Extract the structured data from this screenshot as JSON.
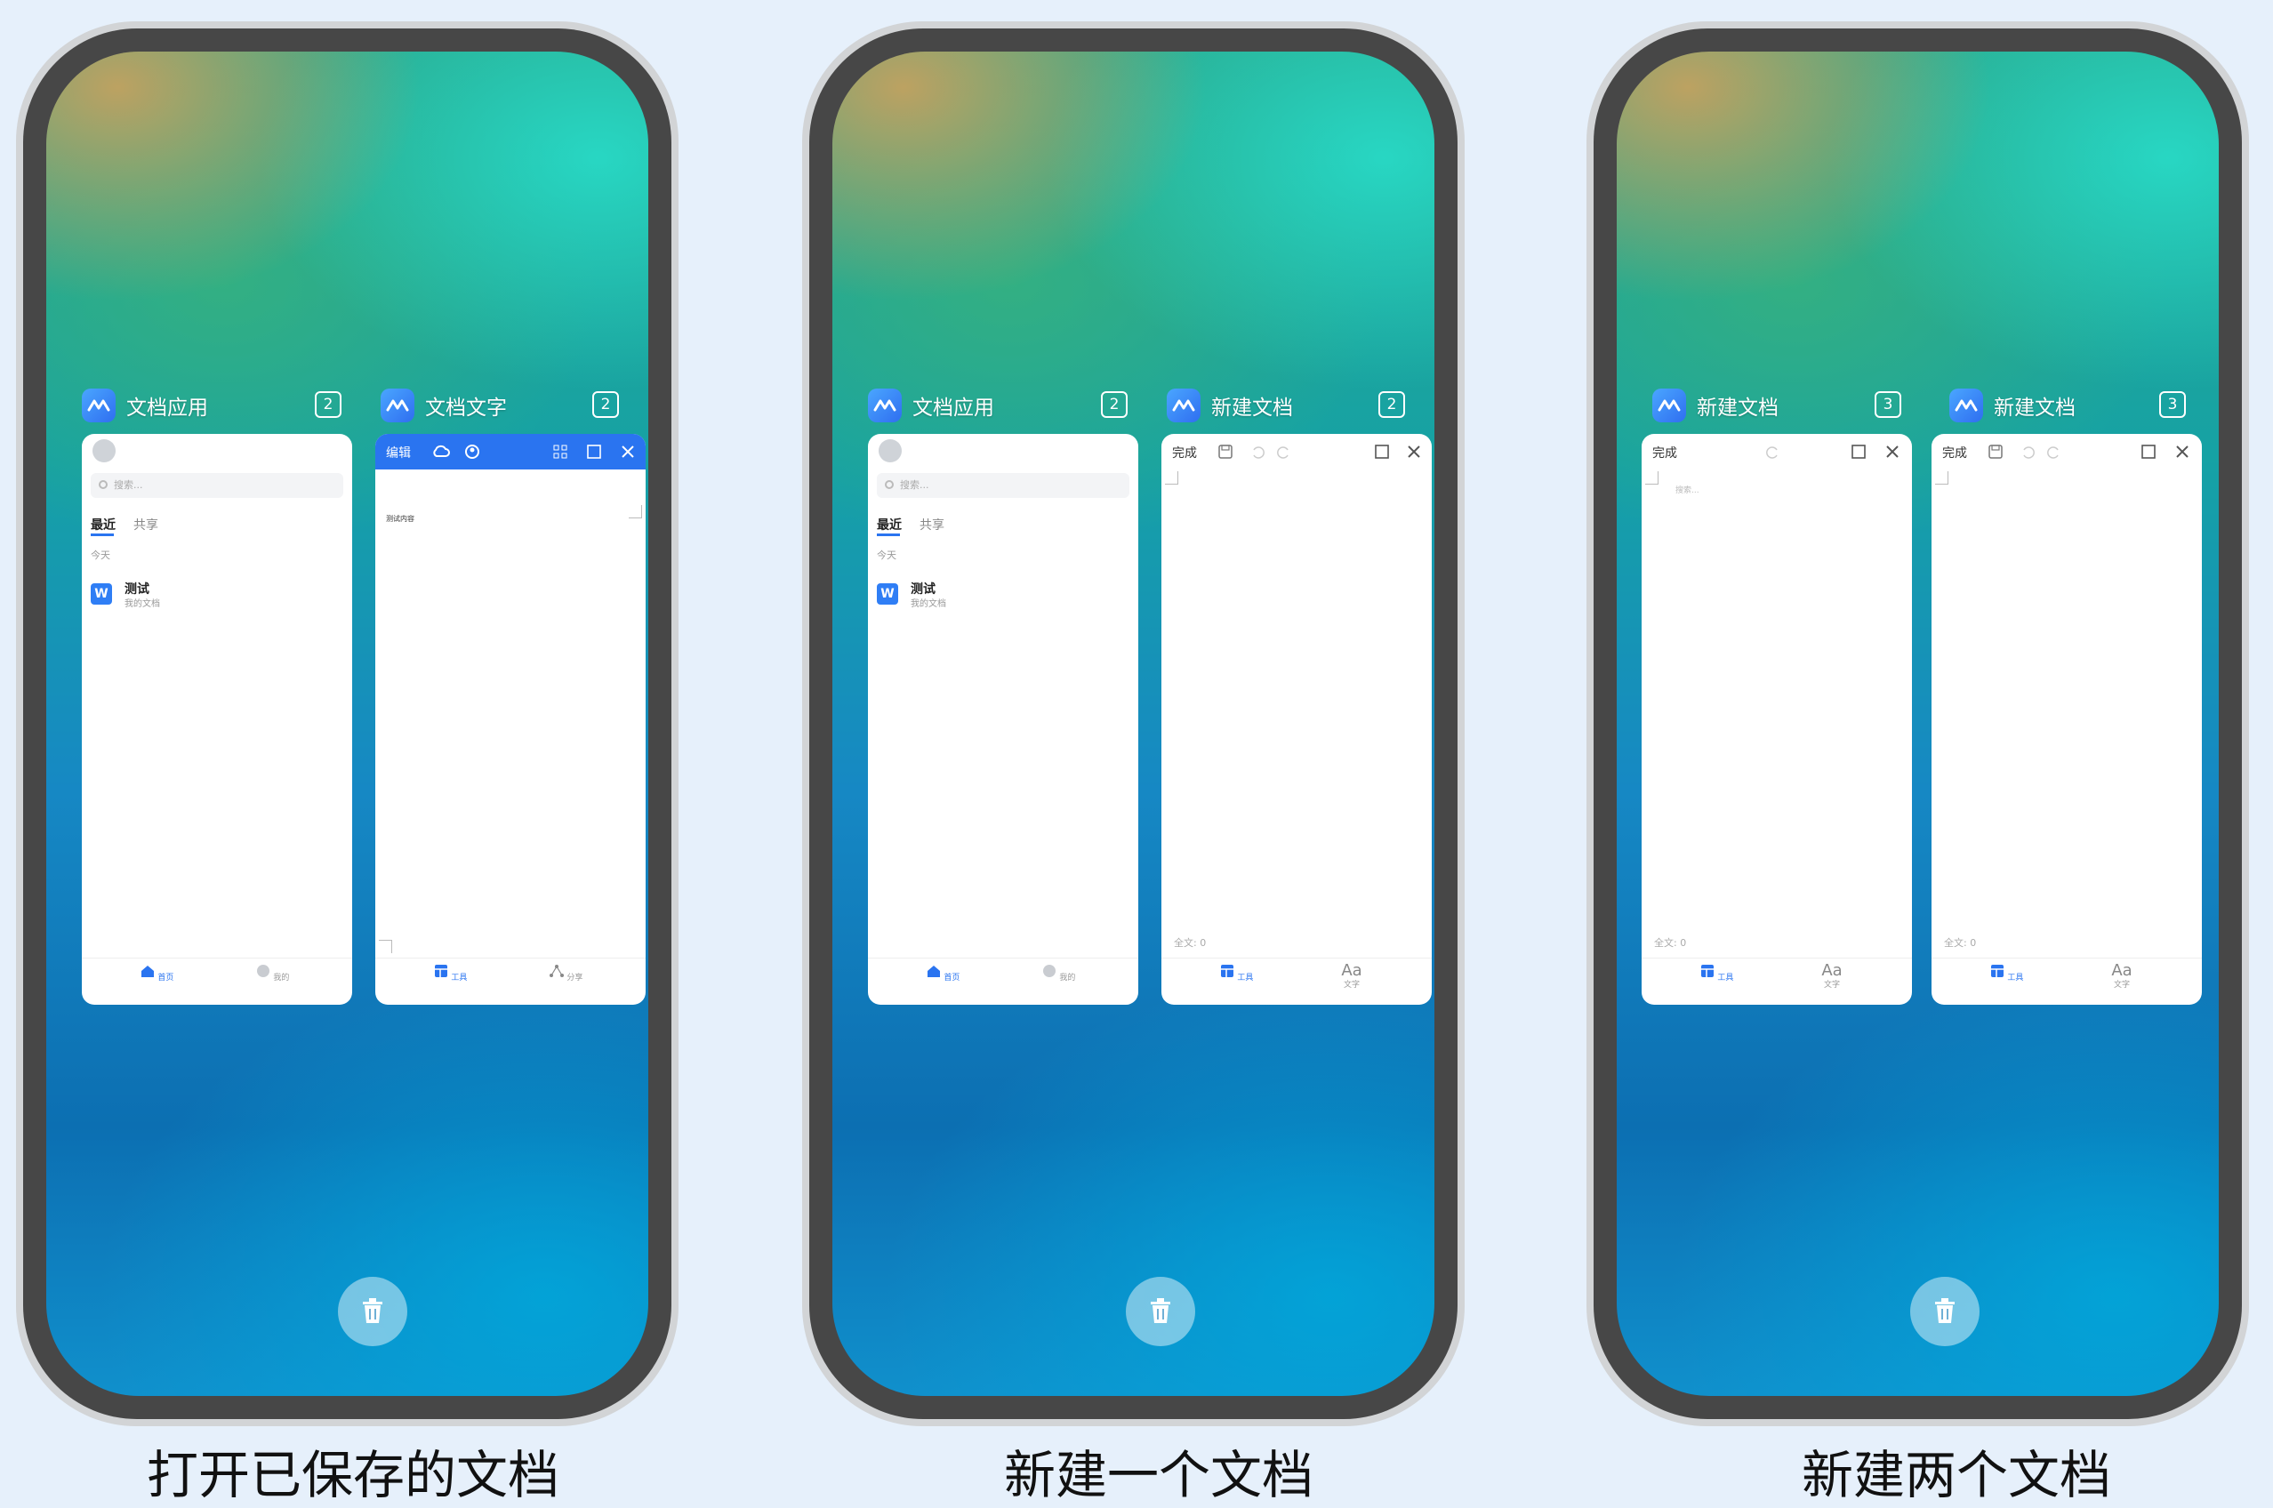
{
  "panels": [
    {
      "caption": "打开已保存的文档",
      "cards": [
        {
          "app_name": "文档应用",
          "count": "2",
          "kind": "list"
        },
        {
          "app_name": "文档文字",
          "count": "2",
          "kind": "editor-blue"
        }
      ]
    },
    {
      "caption": "新建一个文档",
      "cards": [
        {
          "app_name": "文档应用",
          "count": "2",
          "kind": "list"
        },
        {
          "app_name": "新建文档",
          "count": "2",
          "kind": "editor"
        }
      ]
    },
    {
      "caption": "新建两个文档",
      "cards": [
        {
          "app_name": "新建文档",
          "count": "3",
          "kind": "editor"
        },
        {
          "app_name": "新建文档",
          "count": "3",
          "kind": "editor"
        }
      ]
    }
  ],
  "list_app": {
    "search_placeholder": "搜索...",
    "tab_recent": "最近",
    "tab_shared": "共享",
    "section_today": "今天",
    "file_icon_letter": "W",
    "file_name": "测试",
    "file_sub": "我的文档",
    "nav_home": "首页",
    "nav_mine": "我的"
  },
  "editor_blue": {
    "edit_label": "编辑",
    "body_text": "测试内容",
    "nav_tools": "工具",
    "nav_share": "分享"
  },
  "editor": {
    "done_label": "完成",
    "placeholder": "搜索...",
    "word_count": "全文: 0",
    "nav_tools": "工具",
    "nav_text_icon": "Aa",
    "nav_text": "文字"
  },
  "colors": {
    "accent": "#2a74f0",
    "page_bg": "#e6f0fb"
  }
}
